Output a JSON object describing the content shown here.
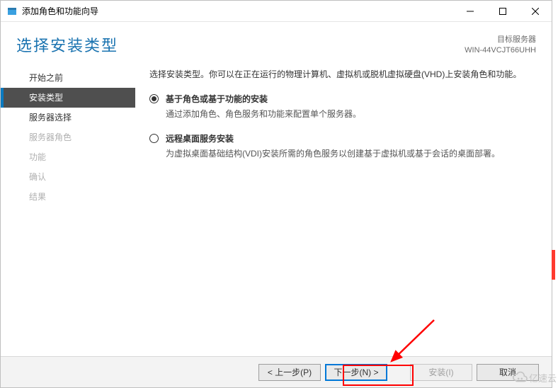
{
  "window": {
    "title": "添加角色和功能向导"
  },
  "header": {
    "page_title": "选择安装类型",
    "target_label": "目标服务器",
    "target_server": "WIN-44VCJT66UHH"
  },
  "sidebar": {
    "items": [
      {
        "label": "开始之前",
        "state": "enabled"
      },
      {
        "label": "安装类型",
        "state": "selected"
      },
      {
        "label": "服务器选择",
        "state": "enabled"
      },
      {
        "label": "服务器角色",
        "state": "disabled"
      },
      {
        "label": "功能",
        "state": "disabled"
      },
      {
        "label": "确认",
        "state": "disabled"
      },
      {
        "label": "结果",
        "state": "disabled"
      }
    ]
  },
  "content": {
    "instruction": "选择安装类型。你可以在正在运行的物理计算机、虚拟机或脱机虚拟硬盘(VHD)上安装角色和功能。",
    "options": [
      {
        "title": "基于角色或基于功能的安装",
        "desc": "通过添加角色、角色服务和功能来配置单个服务器。",
        "checked": true
      },
      {
        "title": "远程桌面服务安装",
        "desc": "为虚拟桌面基础结构(VDI)安装所需的角色服务以创建基于虚拟机或基于会话的桌面部署。",
        "checked": false
      }
    ]
  },
  "footer": {
    "back": "< 上一步(P)",
    "next": "下一步(N) >",
    "install": "安装(I)",
    "cancel": "取消"
  },
  "watermark": {
    "text": "亿速云"
  },
  "colors": {
    "accent": "#0078d7",
    "sidebar_selected_bg": "#4f4f4f",
    "title_color": "#1a73b0",
    "highlight": "#ff0000"
  }
}
